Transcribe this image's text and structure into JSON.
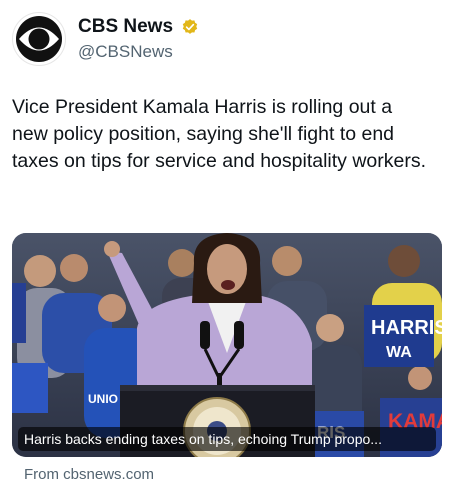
{
  "account": {
    "display_name": "CBS News",
    "handle": "@CBSNews",
    "verified_color": "#e2b719"
  },
  "tweet": {
    "text": "Vice President Kamala Harris is rolling out a new policy position, saying she'll fight to end taxes on tips for service and hospitality workers."
  },
  "card": {
    "caption": "Harris backs ending taxes on tips, echoing Trump propo...",
    "source": "From cbsnews.com",
    "signs": {
      "right_sign": "HARRIS",
      "right_sign_sub": "WA",
      "bottom_right": "KAMA",
      "bottom_mid": "RIS",
      "left_shirt": "UNIO"
    }
  },
  "colors": {
    "text": "#0f1419",
    "secondary": "#536471",
    "suit": "#b9a6d6"
  }
}
